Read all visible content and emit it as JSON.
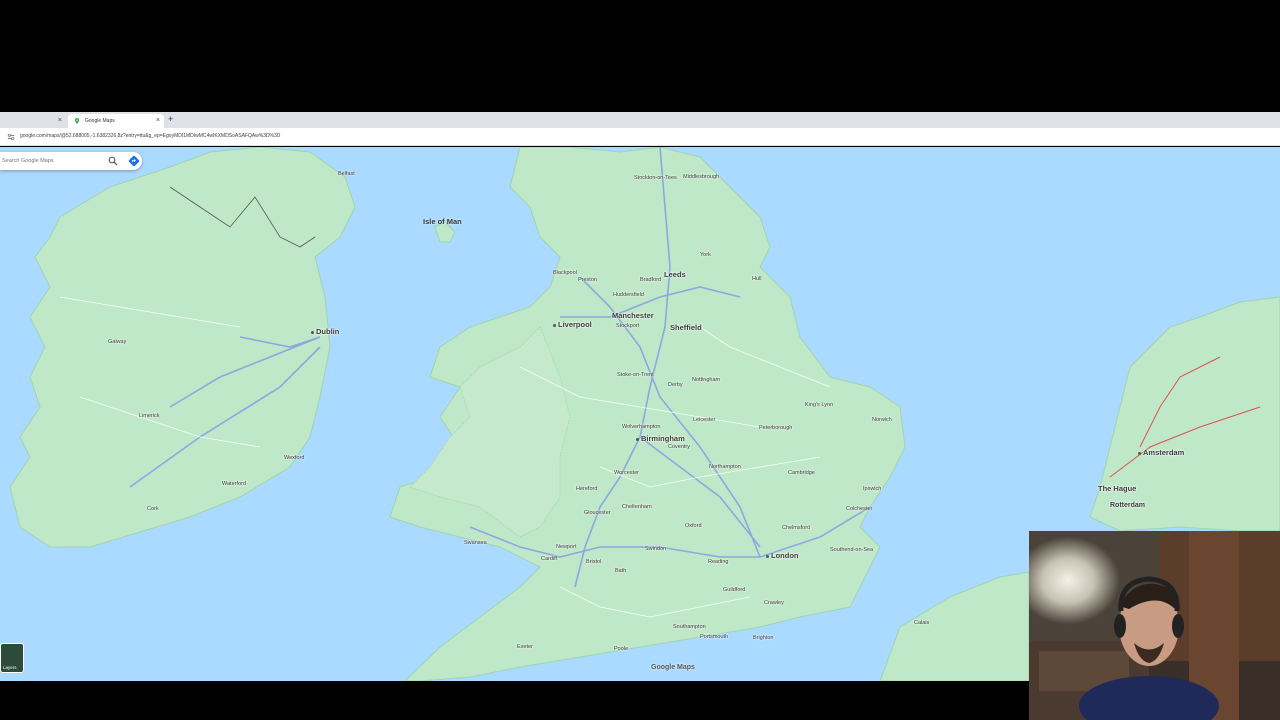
{
  "browser": {
    "tabs": [
      {
        "title": "",
        "active": false
      },
      {
        "title": "Google Maps",
        "active": true
      }
    ],
    "new_tab_label": "+",
    "url": "google.com/maps/@52.688005,-1.6382326,8z?entry=ttu&g_ep=EgoyMDI1MDIwMC4wIKXMDSoASAFQAw%3D%3D"
  },
  "search": {
    "placeholder": "Search Google Maps"
  },
  "map": {
    "attribution": "Google Maps",
    "layers_label": "Layers",
    "colors": {
      "water": "#aadaff",
      "land": "#bfe8c8",
      "roads": "#ffffff",
      "motorway": "#8ca8e0"
    },
    "labels": {
      "isle_of_man": "Isle of Man",
      "leeds": "Leeds",
      "manchester": "Manchester",
      "liverpool": "Liverpool",
      "sheffield": "Sheffield",
      "birmingham": "Birmingham",
      "london": "London",
      "dublin": "Dublin",
      "amsterdam": "Amsterdam",
      "the_hague": "The Hague",
      "rotterdam": "Rotterdam",
      "stockport": "Stockport",
      "stockton": "Stockton-on-Tees",
      "middlesbrough": "Middlesbrough",
      "york": "York",
      "hull": "Hull",
      "preston": "Preston",
      "blackpool": "Blackpool",
      "bradford": "Bradford",
      "huddersfield": "Huddersfield",
      "stoke": "Stoke-on-Trent",
      "derby": "Derby",
      "nottingham": "Nottingham",
      "leicester": "Leicester",
      "wolverhampton": "Wolverhampton",
      "coventry": "Coventry",
      "peterborough": "Peterborough",
      "cambridge": "Cambridge",
      "norwich": "Norwich",
      "ipswich": "Ipswich",
      "colchester": "Colchester",
      "chelmsford": "Chelmsford",
      "southend": "Southend-on-Sea",
      "oxford": "Oxford",
      "reading": "Reading",
      "swindon": "Swindon",
      "gloucester": "Gloucester",
      "cheltenham": "Cheltenham",
      "worcester": "Worcester",
      "hereford": "Hereford",
      "northampton": "Northampton",
      "cardiff": "Cardiff",
      "swansea": "Swansea",
      "newport": "Newport",
      "bristol": "Bristol",
      "bath": "Bath",
      "southampton": "Southampton",
      "portsmouth": "Portsmouth",
      "brighton": "Brighton",
      "crawley": "Crawley",
      "guildford": "Guildford",
      "exeter": "Exeter",
      "poole": "Poole",
      "belfast": "Belfast",
      "galway": "Galway",
      "limerick": "Limerick",
      "cork": "Cork",
      "waterford": "Waterford",
      "wexford": "Wexford",
      "kings_lynn": "King's Lynn",
      "calais": "Calais"
    }
  }
}
